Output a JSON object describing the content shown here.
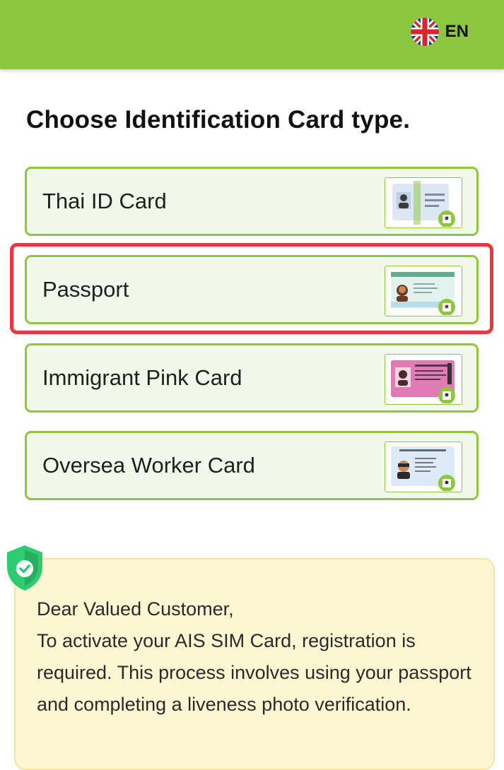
{
  "header": {
    "language_label": "EN",
    "language_icon": "uk-flag-icon",
    "accent_color": "#8dc63f"
  },
  "page": {
    "title": "Choose Identification Card type."
  },
  "card_types": [
    {
      "label": "Thai ID Card",
      "icon": "thai-id-card-icon",
      "selected": false
    },
    {
      "label": "Passport",
      "icon": "passport-icon",
      "selected": true
    },
    {
      "label": "Immigrant Pink Card",
      "icon": "pink-card-icon",
      "selected": false
    },
    {
      "label": "Oversea Worker Card",
      "icon": "worker-card-icon",
      "selected": false
    }
  ],
  "notice": {
    "icon": "shield-check-icon",
    "text": "Dear Valued Customer,\nTo activate your AIS SIM Card, registration is required. This process involves using your passport and completing a liveness photo verification."
  },
  "colors": {
    "highlight": "#e8383d",
    "notice_bg": "#fdf6d3"
  }
}
